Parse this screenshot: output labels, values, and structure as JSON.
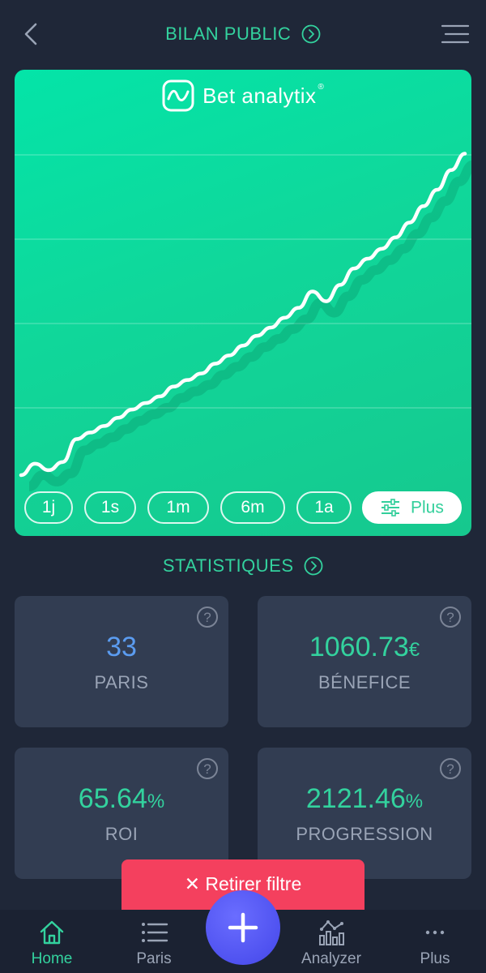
{
  "header": {
    "title": "BILAN PUBLIC"
  },
  "brand": {
    "name": "Bet analytix",
    "reg": "®"
  },
  "chart_data": {
    "type": "line",
    "title": "",
    "xlabel": "",
    "ylabel": "",
    "x": [
      0,
      1,
      2,
      3,
      4,
      5,
      6,
      7,
      8,
      9,
      10,
      11,
      12,
      13,
      14,
      15,
      16,
      17,
      18,
      19,
      20,
      21,
      22,
      23,
      24,
      25,
      26,
      27,
      28,
      29,
      30,
      31,
      32
    ],
    "ylim": [
      0,
      2200
    ],
    "grid": true,
    "series": [
      {
        "values": [
          0,
          70,
          30,
          80,
          220,
          260,
          300,
          350,
          400,
          440,
          480,
          540,
          580,
          620,
          680,
          730,
          790,
          850,
          900,
          960,
          1020,
          1120,
          1060,
          1160,
          1260,
          1320,
          1380,
          1450,
          1540,
          1640,
          1740,
          1860,
          1960
        ]
      }
    ],
    "colors": {
      "line": "#ffffff",
      "gridline": "rgba(255,255,255,0.35)",
      "background": "#0ad9a0"
    }
  },
  "ranges": [
    "1j",
    "1s",
    "1m",
    "6m",
    "1a"
  ],
  "more_label": "Plus",
  "stats": {
    "heading": "STATISTIQUES",
    "paris": {
      "value": "33",
      "label": "PARIS"
    },
    "benefice": {
      "value": "1060.73",
      "unit": "€",
      "label": "BÉNEFICE"
    },
    "roi": {
      "value": "65.64",
      "unit": "%",
      "label": "ROI"
    },
    "progression": {
      "value": "2121.46",
      "unit": "%",
      "label": "PROGRESSION"
    }
  },
  "filter_button": {
    "label": "✕ Retirer filtre"
  },
  "nav": {
    "home": "Home",
    "paris": "Paris",
    "analyzer": "Analyzer",
    "plus": "Plus"
  },
  "colors": {
    "accent": "#33d29e",
    "blue_value": "#5b9cf0",
    "background": "#1f2738",
    "card": "#323d52",
    "danger": "#f4405e",
    "fab": "#4f52f0"
  }
}
